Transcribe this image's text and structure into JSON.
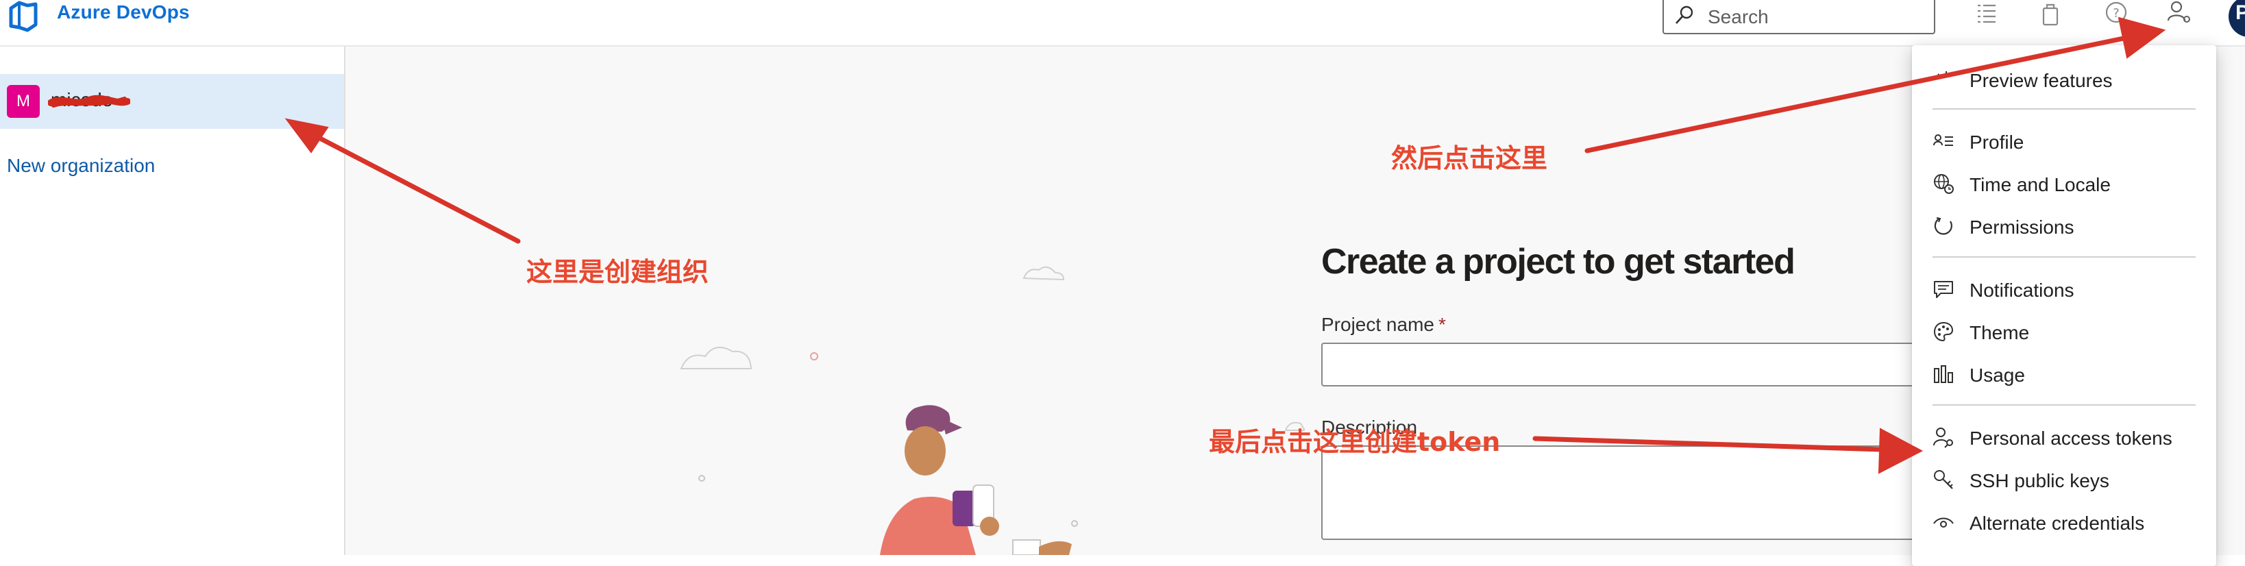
{
  "header": {
    "brand": "Azure DevOps",
    "search_placeholder": "Search",
    "user_initial": "P",
    "icons": [
      "azure-devops-logo",
      "search-icon",
      "work-items-icon",
      "marketplace-icon",
      "help-icon",
      "user-settings-icon"
    ]
  },
  "sidebar": {
    "org": {
      "avatar_letter": "M",
      "name": "micode"
    },
    "new_org": "New organization"
  },
  "main": {
    "title": "Create a project to get started",
    "project_name_label": "Project name",
    "required_mark": "*",
    "description_label": "Description"
  },
  "menu": {
    "preview": "Preview features",
    "profile": "Profile",
    "time_locale": "Time and Locale",
    "permissions": "Permissions",
    "notifications": "Notifications",
    "theme": "Theme",
    "usage": "Usage",
    "pat": "Personal access tokens",
    "ssh": "SSH public keys",
    "alt_creds": "Alternate credentials"
  },
  "annotations": {
    "create_org": "这里是创建组织",
    "then_click": "然后点击这里",
    "finally_click": "最后点击这里创建token"
  },
  "colors": {
    "brand_blue": "#0e6fd2",
    "link_blue": "#0e5aa7",
    "org_avatar": "#e3008c",
    "annotation_red": "#e8482f",
    "selected_row": "#deecf9"
  }
}
